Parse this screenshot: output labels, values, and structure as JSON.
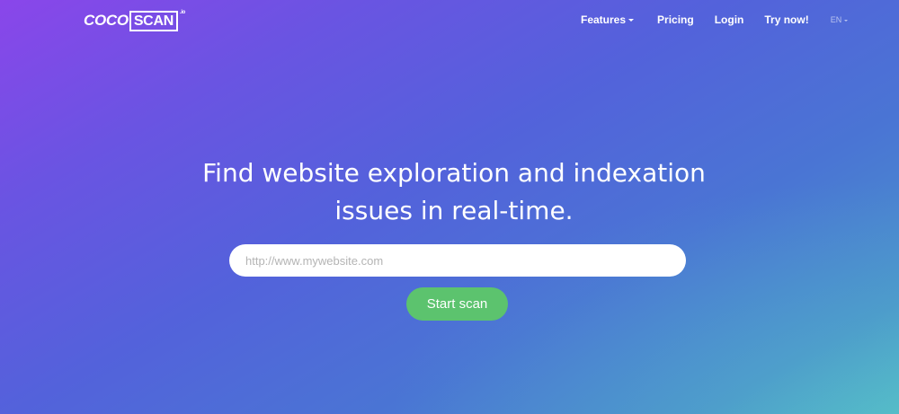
{
  "header": {
    "logo": {
      "part1": "COCO",
      "part2": "SCAN",
      "suffix": ".io"
    },
    "nav": {
      "features": "Features",
      "pricing": "Pricing",
      "login": "Login",
      "try_now": "Try now!",
      "language": "EN"
    }
  },
  "hero": {
    "headline": "Find website exploration and indexation issues in real-time.",
    "url_input": {
      "value": "",
      "placeholder": "http://www.mywebsite.com"
    },
    "cta_label": "Start scan"
  },
  "colors": {
    "gradient_start": "#8a46ea",
    "gradient_mid": "#5362db",
    "gradient_end": "#52b6c8",
    "cta_green": "#5cc36e"
  },
  "icons": {
    "features_dropdown": "chevron-down-icon",
    "language_dropdown": "chevron-down-icon"
  }
}
